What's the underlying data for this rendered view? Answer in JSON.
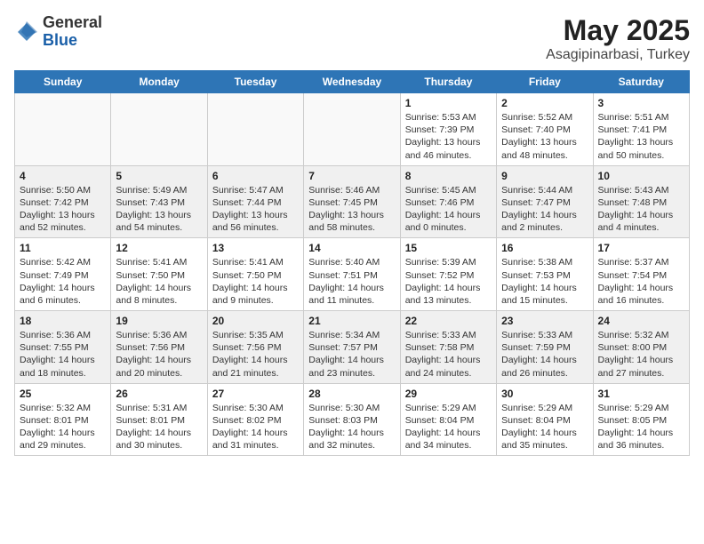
{
  "header": {
    "logo_general": "General",
    "logo_blue": "Blue",
    "title": "May 2025",
    "location": "Asagipinarbasi, Turkey"
  },
  "days_of_week": [
    "Sunday",
    "Monday",
    "Tuesday",
    "Wednesday",
    "Thursday",
    "Friday",
    "Saturday"
  ],
  "weeks": [
    {
      "shaded": false,
      "days": [
        {
          "number": "",
          "info": ""
        },
        {
          "number": "",
          "info": ""
        },
        {
          "number": "",
          "info": ""
        },
        {
          "number": "",
          "info": ""
        },
        {
          "number": "1",
          "info": "Sunrise: 5:53 AM\nSunset: 7:39 PM\nDaylight: 13 hours\nand 46 minutes."
        },
        {
          "number": "2",
          "info": "Sunrise: 5:52 AM\nSunset: 7:40 PM\nDaylight: 13 hours\nand 48 minutes."
        },
        {
          "number": "3",
          "info": "Sunrise: 5:51 AM\nSunset: 7:41 PM\nDaylight: 13 hours\nand 50 minutes."
        }
      ]
    },
    {
      "shaded": true,
      "days": [
        {
          "number": "4",
          "info": "Sunrise: 5:50 AM\nSunset: 7:42 PM\nDaylight: 13 hours\nand 52 minutes."
        },
        {
          "number": "5",
          "info": "Sunrise: 5:49 AM\nSunset: 7:43 PM\nDaylight: 13 hours\nand 54 minutes."
        },
        {
          "number": "6",
          "info": "Sunrise: 5:47 AM\nSunset: 7:44 PM\nDaylight: 13 hours\nand 56 minutes."
        },
        {
          "number": "7",
          "info": "Sunrise: 5:46 AM\nSunset: 7:45 PM\nDaylight: 13 hours\nand 58 minutes."
        },
        {
          "number": "8",
          "info": "Sunrise: 5:45 AM\nSunset: 7:46 PM\nDaylight: 14 hours\nand 0 minutes."
        },
        {
          "number": "9",
          "info": "Sunrise: 5:44 AM\nSunset: 7:47 PM\nDaylight: 14 hours\nand 2 minutes."
        },
        {
          "number": "10",
          "info": "Sunrise: 5:43 AM\nSunset: 7:48 PM\nDaylight: 14 hours\nand 4 minutes."
        }
      ]
    },
    {
      "shaded": false,
      "days": [
        {
          "number": "11",
          "info": "Sunrise: 5:42 AM\nSunset: 7:49 PM\nDaylight: 14 hours\nand 6 minutes."
        },
        {
          "number": "12",
          "info": "Sunrise: 5:41 AM\nSunset: 7:50 PM\nDaylight: 14 hours\nand 8 minutes."
        },
        {
          "number": "13",
          "info": "Sunrise: 5:41 AM\nSunset: 7:50 PM\nDaylight: 14 hours\nand 9 minutes."
        },
        {
          "number": "14",
          "info": "Sunrise: 5:40 AM\nSunset: 7:51 PM\nDaylight: 14 hours\nand 11 minutes."
        },
        {
          "number": "15",
          "info": "Sunrise: 5:39 AM\nSunset: 7:52 PM\nDaylight: 14 hours\nand 13 minutes."
        },
        {
          "number": "16",
          "info": "Sunrise: 5:38 AM\nSunset: 7:53 PM\nDaylight: 14 hours\nand 15 minutes."
        },
        {
          "number": "17",
          "info": "Sunrise: 5:37 AM\nSunset: 7:54 PM\nDaylight: 14 hours\nand 16 minutes."
        }
      ]
    },
    {
      "shaded": true,
      "days": [
        {
          "number": "18",
          "info": "Sunrise: 5:36 AM\nSunset: 7:55 PM\nDaylight: 14 hours\nand 18 minutes."
        },
        {
          "number": "19",
          "info": "Sunrise: 5:36 AM\nSunset: 7:56 PM\nDaylight: 14 hours\nand 20 minutes."
        },
        {
          "number": "20",
          "info": "Sunrise: 5:35 AM\nSunset: 7:56 PM\nDaylight: 14 hours\nand 21 minutes."
        },
        {
          "number": "21",
          "info": "Sunrise: 5:34 AM\nSunset: 7:57 PM\nDaylight: 14 hours\nand 23 minutes."
        },
        {
          "number": "22",
          "info": "Sunrise: 5:33 AM\nSunset: 7:58 PM\nDaylight: 14 hours\nand 24 minutes."
        },
        {
          "number": "23",
          "info": "Sunrise: 5:33 AM\nSunset: 7:59 PM\nDaylight: 14 hours\nand 26 minutes."
        },
        {
          "number": "24",
          "info": "Sunrise: 5:32 AM\nSunset: 8:00 PM\nDaylight: 14 hours\nand 27 minutes."
        }
      ]
    },
    {
      "shaded": false,
      "days": [
        {
          "number": "25",
          "info": "Sunrise: 5:32 AM\nSunset: 8:01 PM\nDaylight: 14 hours\nand 29 minutes."
        },
        {
          "number": "26",
          "info": "Sunrise: 5:31 AM\nSunset: 8:01 PM\nDaylight: 14 hours\nand 30 minutes."
        },
        {
          "number": "27",
          "info": "Sunrise: 5:30 AM\nSunset: 8:02 PM\nDaylight: 14 hours\nand 31 minutes."
        },
        {
          "number": "28",
          "info": "Sunrise: 5:30 AM\nSunset: 8:03 PM\nDaylight: 14 hours\nand 32 minutes."
        },
        {
          "number": "29",
          "info": "Sunrise: 5:29 AM\nSunset: 8:04 PM\nDaylight: 14 hours\nand 34 minutes."
        },
        {
          "number": "30",
          "info": "Sunrise: 5:29 AM\nSunset: 8:04 PM\nDaylight: 14 hours\nand 35 minutes."
        },
        {
          "number": "31",
          "info": "Sunrise: 5:29 AM\nSunset: 8:05 PM\nDaylight: 14 hours\nand 36 minutes."
        }
      ]
    }
  ]
}
